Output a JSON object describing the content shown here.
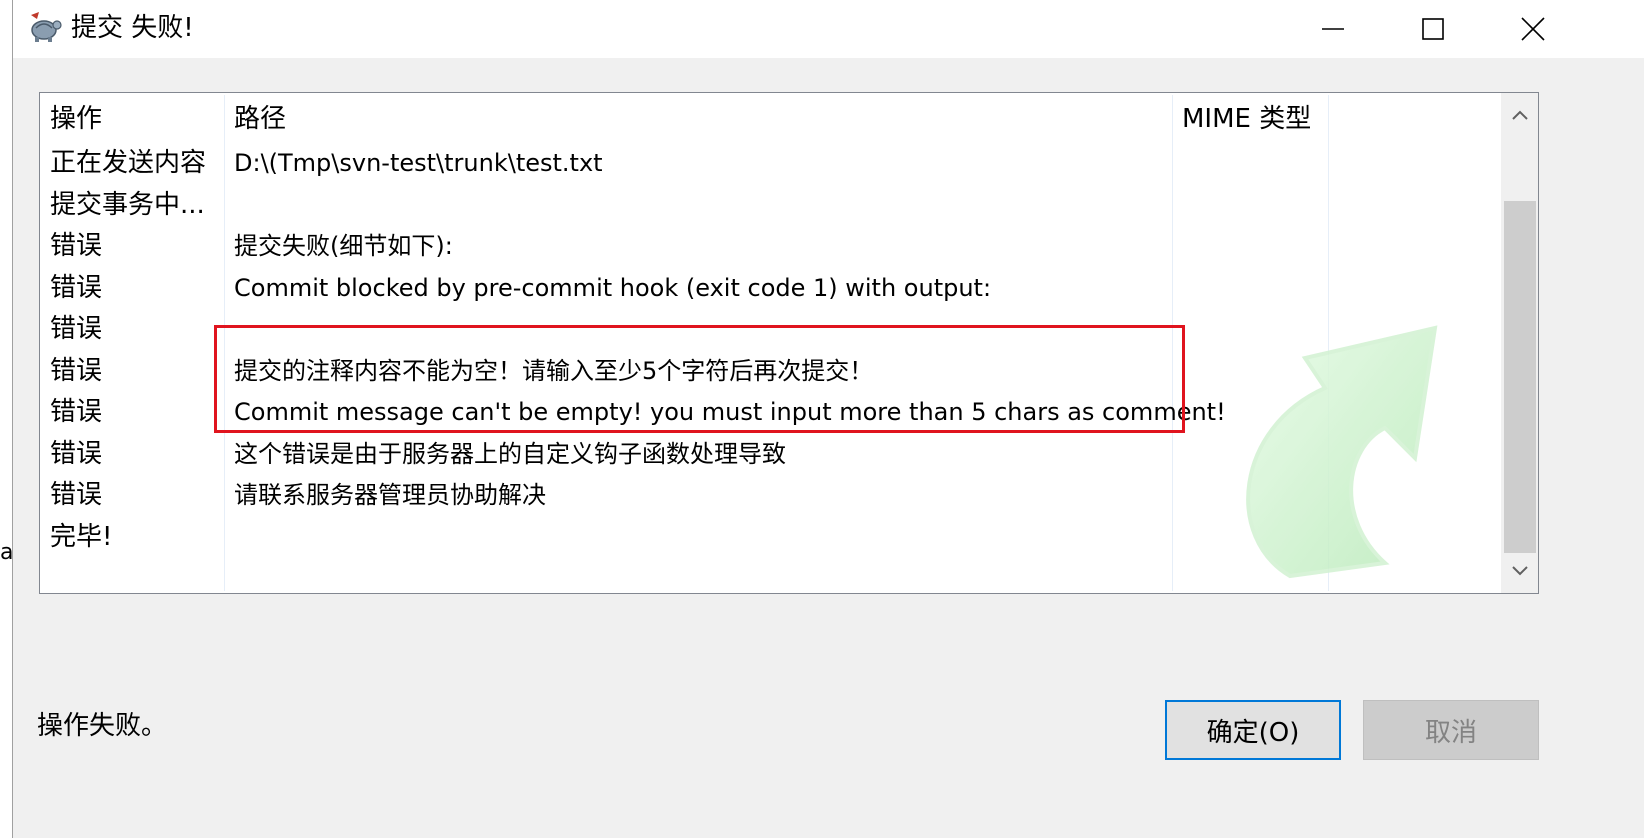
{
  "stray_char": "a",
  "window": {
    "title": "提交 失败!",
    "icon": "tortoise-svn-icon",
    "controls": {
      "minimize": "minimize-icon",
      "maximize": "maximize-icon",
      "close": "close-icon"
    }
  },
  "list": {
    "columns": {
      "action": "操作",
      "path": "路径",
      "mime": "MIME 类型"
    },
    "rows": [
      {
        "action": "正在发送内容",
        "path": "D:\\(Tmp\\svn-test\\trunk\\test.txt"
      },
      {
        "action": "提交事务中...",
        "path": ""
      },
      {
        "action": "错误",
        "path": "提交失败(细节如下):"
      },
      {
        "action": "错误",
        "path": "Commit blocked by pre-commit hook (exit code 1) with output:"
      },
      {
        "action": "错误",
        "path": ""
      },
      {
        "action": "错误",
        "path": "提交的注释内容不能为空！请输入至少5个字符后再次提交！"
      },
      {
        "action": "错误",
        "path": "Commit message can't be empty! you must input more than 5 chars as comment!"
      },
      {
        "action": "错误",
        "path": "这个错误是由于服务器上的自定义钩子函数处理导致"
      },
      {
        "action": "错误",
        "path": "请联系服务器管理员协助解决"
      },
      {
        "action": "完毕!",
        "path": ""
      }
    ],
    "highlight_color": "#e0141e",
    "watermark_icon": "commit-arrow-icon"
  },
  "footer": {
    "status": "操作失败。",
    "ok_label": "确定(O)",
    "cancel_label": "取消"
  }
}
